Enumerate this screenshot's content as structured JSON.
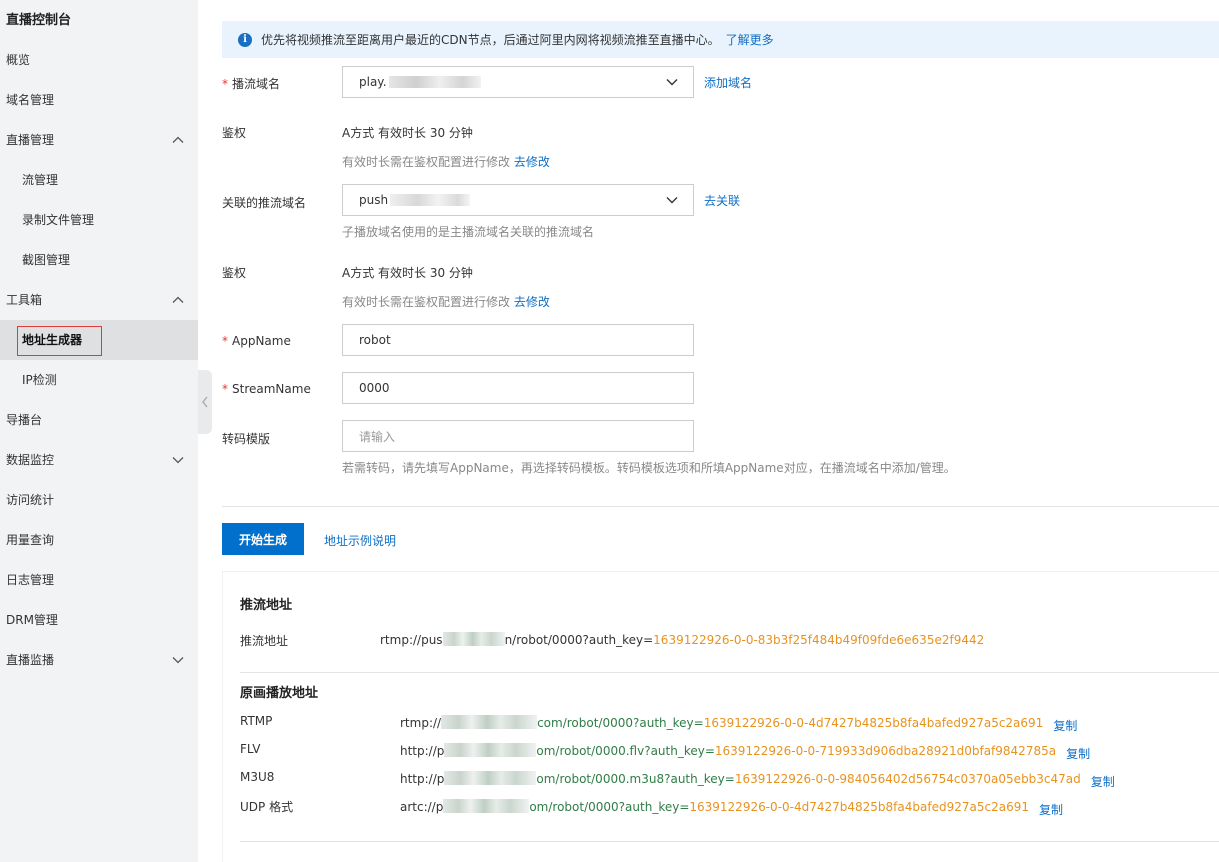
{
  "sidebar": {
    "title": "直播控制台",
    "items": [
      {
        "label": "概览",
        "sub": false,
        "chevron": "none"
      },
      {
        "label": "域名管理",
        "sub": false,
        "chevron": "none"
      },
      {
        "label": "直播管理",
        "sub": false,
        "chevron": "up"
      },
      {
        "label": "流管理",
        "sub": true,
        "chevron": "none"
      },
      {
        "label": "录制文件管理",
        "sub": true,
        "chevron": "none"
      },
      {
        "label": "截图管理",
        "sub": true,
        "chevron": "none"
      },
      {
        "label": "工具箱",
        "sub": false,
        "chevron": "up"
      },
      {
        "label": "地址生成器",
        "sub": true,
        "chevron": "none",
        "active": true
      },
      {
        "label": "IP检测",
        "sub": true,
        "chevron": "none"
      },
      {
        "label": "导播台",
        "sub": false,
        "chevron": "none"
      },
      {
        "label": "数据监控",
        "sub": false,
        "chevron": "down"
      },
      {
        "label": "访问统计",
        "sub": false,
        "chevron": "none"
      },
      {
        "label": "用量查询",
        "sub": false,
        "chevron": "none"
      },
      {
        "label": "日志管理",
        "sub": false,
        "chevron": "none"
      },
      {
        "label": "DRM管理",
        "sub": false,
        "chevron": "none"
      },
      {
        "label": "直播监播",
        "sub": false,
        "chevron": "down"
      }
    ]
  },
  "notice": {
    "text": "优先将视频推流至距离用户最近的CDN节点，后通过阿里内网将视频流推至直播中心。",
    "link": "了解更多"
  },
  "form": {
    "play_domain": {
      "label": "播流域名",
      "value": "play.",
      "action": "添加域名"
    },
    "auth1": {
      "label": "鉴权",
      "value": "A方式 有效时长 30 分钟",
      "hint": "有效时长需在鉴权配置进行修改",
      "hint_link": "去修改"
    },
    "push_domain": {
      "label": "关联的推流域名",
      "value": "push",
      "action": "去关联",
      "hint": "子播放域名使用的是主播流域名关联的推流域名"
    },
    "auth2": {
      "label": "鉴权",
      "value": "A方式 有效时长 30 分钟",
      "hint": "有效时长需在鉴权配置进行修改",
      "hint_link": "去修改"
    },
    "app_name": {
      "label": "AppName",
      "value": "robot"
    },
    "stream_name": {
      "label": "StreamName",
      "value": "0000"
    },
    "template": {
      "label": "转码模版",
      "placeholder": "请输入",
      "hint": "若需转码，请先填写AppName，再选择转码模板。转码模板选项和所填AppName对应，在播流域名中添加/管理。"
    }
  },
  "actions": {
    "generate": "开始生成",
    "example": "地址示例说明"
  },
  "result": {
    "push_section": "推流地址",
    "push_label": "推流地址",
    "push_url": {
      "pre": "rtmp://pus",
      "mid": "n/robot/0000?auth_key=",
      "key": "1639122926-0-0-83b3f25f484b49f09fde6e635e2f9442"
    },
    "play_section": "原画播放地址",
    "copy_label": "复制",
    "play_rows": [
      {
        "label": "RTMP",
        "pre": "rtmp://",
        "mid": "com/robot/0000?auth_key=",
        "key": "1639122926-0-0-4d7427b4825b8fa4bafed927a5c2a691"
      },
      {
        "label": "FLV",
        "pre": "http://p",
        "mid": "om/robot/0000.flv?auth_key=",
        "key": "1639122926-0-0-719933d906dba28921d0bfaf9842785a"
      },
      {
        "label": "M3U8",
        "pre": "http://p",
        "mid": "om/robot/0000.m3u8?auth_key=",
        "key": "1639122926-0-0-984056402d56754c0370a05ebb3c47ad"
      },
      {
        "label": "UDP 格式",
        "pre": "artc://p",
        "mid": "om/robot/0000?auth_key=",
        "key": "1639122926-0-0-4d7427b4825b8fa4bafed927a5c2a691"
      }
    ]
  }
}
